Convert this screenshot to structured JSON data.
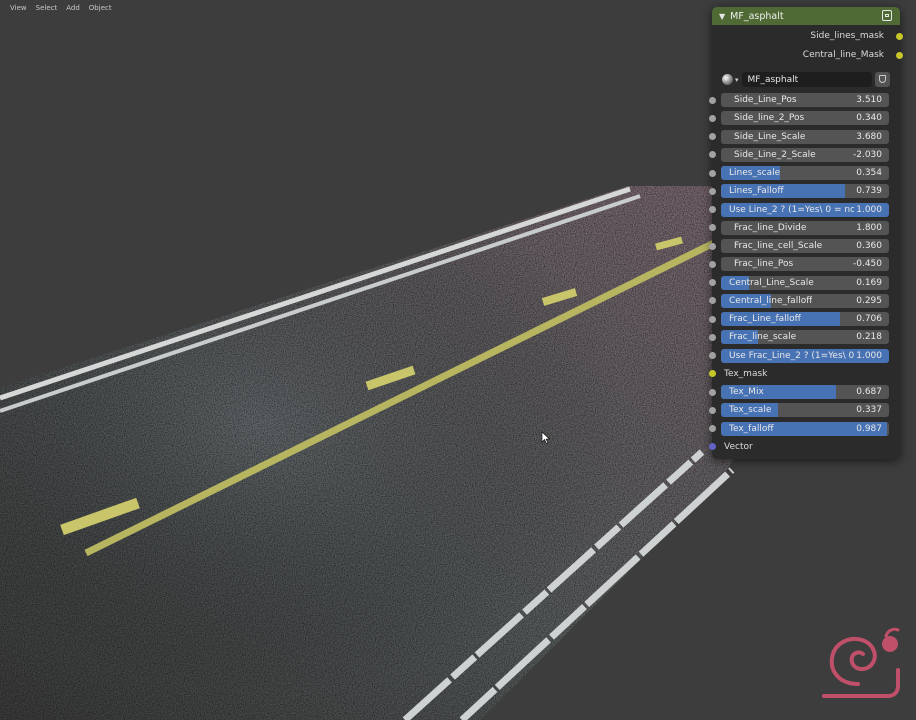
{
  "menu": [
    "View",
    "Select",
    "Add",
    "Object"
  ],
  "node": {
    "title": "MF_asphalt",
    "collapse_icon": "triangle-down-icon",
    "group_icon": "node-group-icon",
    "outputs": [
      "Side_lines_mask",
      "Central_line_Mask"
    ],
    "material": {
      "name": "MF_asphalt",
      "icon": "material-sphere-icon",
      "fake_user_icon": "shield-icon"
    },
    "inputs": [
      {
        "label": "Side_Line_Pos",
        "value": "3.510",
        "kind": "number"
      },
      {
        "label": "Side_line_2_Pos",
        "value": "0.340",
        "kind": "number"
      },
      {
        "label": "Side_Line_Scale",
        "value": "3.680",
        "kind": "number"
      },
      {
        "label": "Side_Line_2_Scale",
        "value": "-2.030",
        "kind": "number"
      },
      {
        "label": "Lines_scale",
        "value": "0.354",
        "kind": "slider",
        "fill": 0.354
      },
      {
        "label": "Lines_Falloff",
        "value": "0.739",
        "kind": "slider",
        "fill": 0.739
      },
      {
        "label": "Use Line_2 ?  (1=Yes\\ 0 = no",
        "value": "1.000",
        "kind": "slider",
        "fill": 1.0
      },
      {
        "label": "Frac_line_Divide",
        "value": "1.800",
        "kind": "number"
      },
      {
        "label": "Frac_line_cell_Scale",
        "value": "0.360",
        "kind": "number"
      },
      {
        "label": "Frac_line_Pos",
        "value": "-0.450",
        "kind": "number"
      },
      {
        "label": "Central_Line_Scale",
        "value": "0.169",
        "kind": "slider",
        "fill": 0.169
      },
      {
        "label": "Central_line_falloff",
        "value": "0.295",
        "kind": "slider",
        "fill": 0.295
      },
      {
        "label": "Frac_Line_falloff",
        "value": "0.706",
        "kind": "slider",
        "fill": 0.706
      },
      {
        "label": "Frac_line_scale",
        "value": "0.218",
        "kind": "slider",
        "fill": 0.218
      },
      {
        "label": "Use Frac_Line_2 ?  (1=Yes\\ 0",
        "value": "1.000",
        "kind": "slider",
        "fill": 1.0
      },
      {
        "label": "Tex_mask",
        "value": "",
        "kind": "socket"
      },
      {
        "label": "Tex_Mix",
        "value": "0.687",
        "kind": "slider",
        "fill": 0.687
      },
      {
        "label": "Tex_scale",
        "value": "0.337",
        "kind": "slider",
        "fill": 0.337
      },
      {
        "label": "Tex_falloff",
        "value": "0.987",
        "kind": "slider",
        "fill": 0.987
      },
      {
        "label": "Vector",
        "value": "",
        "kind": "socket-vector"
      }
    ]
  },
  "viewport": {
    "cursor_icon": "mouse-cursor-icon",
    "logo_icon": "snail-logo-icon",
    "logo_color": "#c0506a"
  },
  "colors": {
    "node_header": "#4f6a34",
    "slider_fill": "#4772b3",
    "field_bg": "#545454",
    "socket_yellow": "#c7c729",
    "socket_grey": "#a1a1a1",
    "socket_purple": "#6363c7"
  }
}
